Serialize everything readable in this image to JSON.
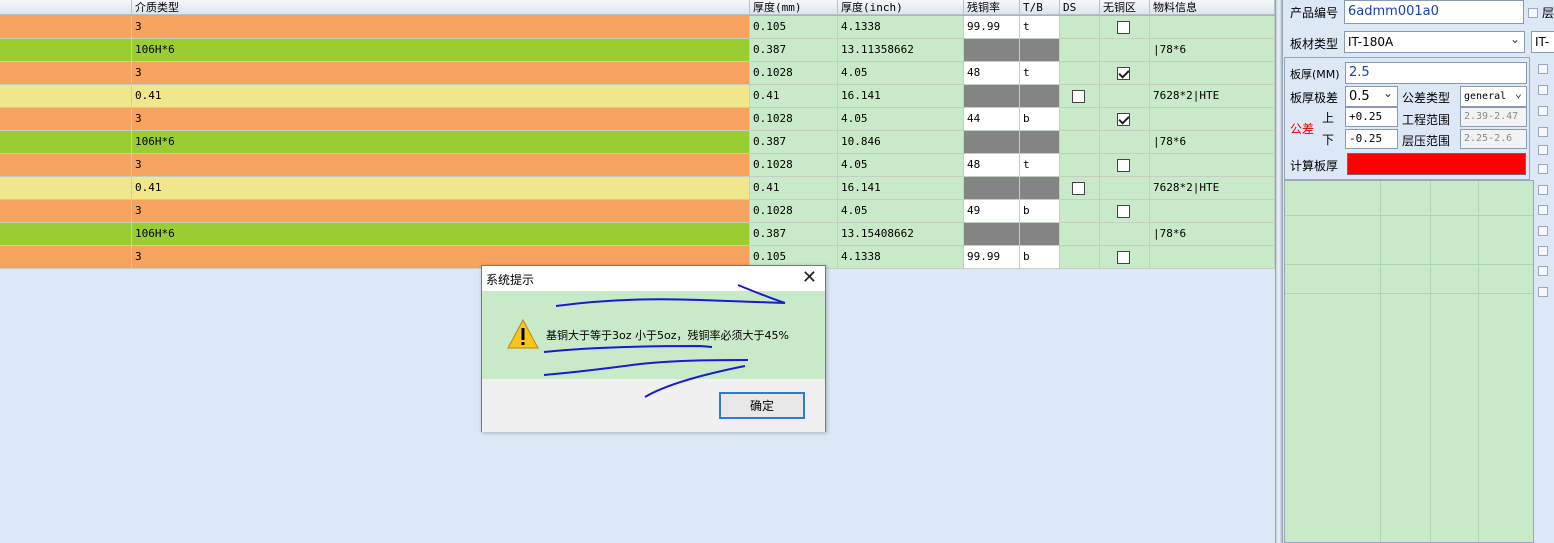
{
  "grid": {
    "headers": [
      "",
      "介质类型",
      "厚度(mm)",
      "厚度(inch)",
      "残铜率",
      "T/B",
      "DS",
      "无铜区",
      "物料信息"
    ],
    "rows": [
      {
        "color": "#f5a35f",
        "type": "3",
        "mm": "0.105",
        "inch": "4.1338",
        "cu": "99.99",
        "tb": "t",
        "ds": false,
        "nocu": "off",
        "mat": ""
      },
      {
        "color": "#9acd32",
        "type": "106H*6",
        "mm": "0.387",
        "inch": "13.11358662",
        "cu": null,
        "tb": null,
        "ds": false,
        "nocu": null,
        "mat": "|78*6"
      },
      {
        "color": "#f5a35f",
        "type": "3",
        "mm": "0.1028",
        "inch": "4.05",
        "cu": "48",
        "tb": "t",
        "ds": false,
        "nocu": "on",
        "mat": ""
      },
      {
        "color": "#f0e68c",
        "type": "0.41",
        "mm": "0.41",
        "inch": "16.141",
        "cu": null,
        "tb": null,
        "ds": true,
        "nocu": null,
        "mat": "7628*2|HTE"
      },
      {
        "color": "#f5a35f",
        "type": "3",
        "mm": "0.1028",
        "inch": "4.05",
        "cu": "44",
        "tb": "b",
        "ds": false,
        "nocu": "on",
        "mat": ""
      },
      {
        "color": "#9acd32",
        "type": "106H*6",
        "mm": "0.387",
        "inch": "10.846",
        "cu": null,
        "tb": null,
        "ds": false,
        "nocu": null,
        "mat": "|78*6"
      },
      {
        "color": "#f5a35f",
        "type": "3",
        "mm": "0.1028",
        "inch": "4.05",
        "cu": "48",
        "tb": "t",
        "ds": false,
        "nocu": "off",
        "mat": ""
      },
      {
        "color": "#f0e68c",
        "type": "0.41",
        "mm": "0.41",
        "inch": "16.141",
        "cu": null,
        "tb": null,
        "ds": true,
        "nocu": null,
        "mat": "7628*2|HTE"
      },
      {
        "color": "#f5a35f",
        "type": "3",
        "mm": "0.1028",
        "inch": "4.05",
        "cu": "49",
        "tb": "b",
        "ds": false,
        "nocu": "off",
        "mat": ""
      },
      {
        "color": "#9acd32",
        "type": "106H*6",
        "mm": "0.387",
        "inch": "13.15408662",
        "cu": null,
        "tb": null,
        "ds": false,
        "nocu": null,
        "mat": "|78*6"
      },
      {
        "color": "#f5a35f",
        "type": "3",
        "mm": "0.105",
        "inch": "4.1338",
        "cu": "99.99",
        "tb": "b",
        "ds": false,
        "nocu": "off",
        "mat": ""
      }
    ]
  },
  "panel": {
    "product_no_label": "产品编号",
    "product_no": "6admm001a0",
    "cut_label": "层",
    "board_type_label": "板材类型",
    "board_type": "IT-180A",
    "board_type2": "IT-",
    "thickness_label": "板厚(MM)",
    "thickness": "2.5",
    "tol_label": "板厚极差",
    "tol_value": "0.5",
    "tol_type_label": "公差类型",
    "tol_type": "general",
    "tol_word": "公差",
    "upper_label": "上",
    "lower_label": "下",
    "upper": "+0.25",
    "lower": "-0.25",
    "eng_range_label": "工程范围",
    "eng_range": "2.39-2.47",
    "press_range_label": "层压范围",
    "press_range": "2.25-2.6",
    "calc_label": "计算板厚",
    "calc_color": "#ff0000"
  },
  "dialog": {
    "title": "系统提示",
    "close": "✕",
    "message": "基铜大于等于3oz 小于5oz，残铜率必须大于45%",
    "ok": "确定",
    "icon": "warning-icon"
  }
}
